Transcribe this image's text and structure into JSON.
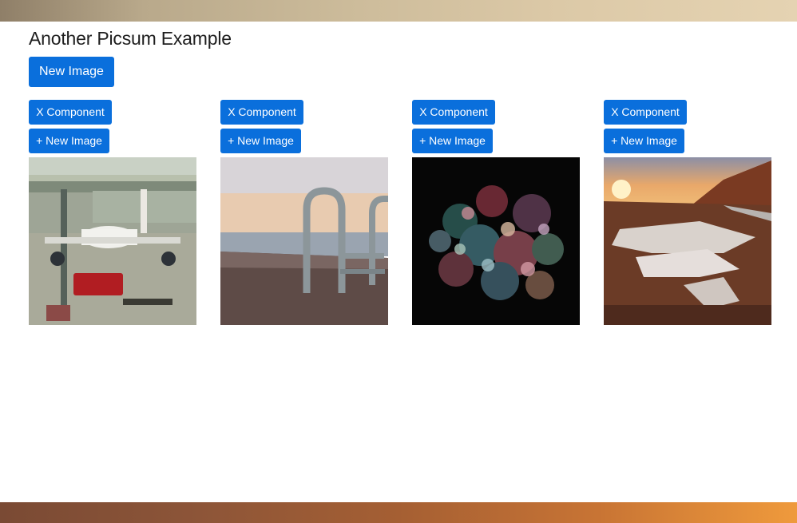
{
  "header": {
    "title": "Another Picsum Example",
    "new_image_label": "New Image"
  },
  "cards": [
    {
      "x_label": "X Component",
      "new_label": "+ New Image",
      "image": "airport-airplane-photo"
    },
    {
      "x_label": "X Component",
      "new_label": "+ New Image",
      "image": "waterfront-railing-photo"
    },
    {
      "x_label": "X Component",
      "new_label": "+ New Image",
      "image": "fireworks-photo"
    },
    {
      "x_label": "X Component",
      "new_label": "+ New Image",
      "image": "sunset-road-photo"
    }
  ],
  "colors": {
    "button": "#0a6fdc",
    "button_text": "#ffffff"
  }
}
